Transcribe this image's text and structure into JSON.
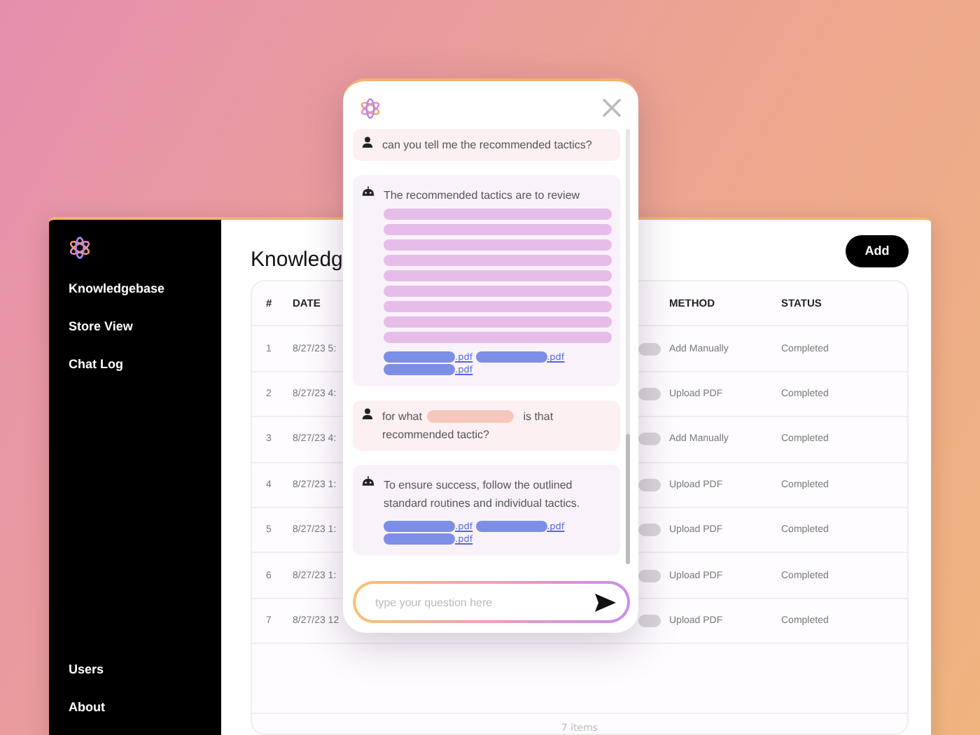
{
  "sidebar": {
    "items": [
      "Knowledgebase",
      "Store View",
      "Chat Log"
    ],
    "bottom_items": [
      "Users",
      "About"
    ]
  },
  "page": {
    "title": "Knowledg",
    "add_button": "Add"
  },
  "table": {
    "columns": [
      "#",
      "DATE",
      "METHOD",
      "STATUS"
    ],
    "rows": [
      {
        "index": "1",
        "date": "8/27/23 5:",
        "toggle_on": false,
        "method": "Add Manually",
        "status": "Completed"
      },
      {
        "index": "2",
        "date": "8/27/23 4:",
        "toggle_on": false,
        "method": "Upload PDF",
        "status": "Completed"
      },
      {
        "index": "3",
        "date": "8/27/23 4:",
        "toggle_on": false,
        "method": "Add Manually",
        "status": "Completed"
      },
      {
        "index": "4",
        "date": "8/27/23 1:",
        "toggle_on": false,
        "method": "Upload PDF",
        "status": "Completed"
      },
      {
        "index": "5",
        "date": "8/27/23 1:",
        "toggle_on": false,
        "method": "Upload PDF",
        "status": "Completed"
      },
      {
        "index": "6",
        "date": "8/27/23 1:",
        "toggle_on": false,
        "method": "Upload PDF",
        "status": "Completed"
      },
      {
        "index": "7",
        "date": "8/27/23 12",
        "toggle_on": false,
        "method": "Upload PDF",
        "status": "Completed"
      }
    ],
    "footer": "7 items"
  },
  "chat": {
    "messages": [
      {
        "kind": "user",
        "text": "can you tell me the recommended tactics?"
      },
      {
        "kind": "bot",
        "text": "The recommended tactics are to review",
        "redacted_block": true,
        "attachments": [
          ".pdf",
          ".pdf",
          ".pdf"
        ]
      },
      {
        "kind": "user",
        "text": "for what",
        "redacted_word": true,
        "text_after": "is that recommended tactic?"
      },
      {
        "kind": "bot",
        "text": "To ensure success, follow the outlined standard routines and individual tactics.",
        "attachments": [
          ".pdf",
          ".pdf",
          ".pdf"
        ]
      }
    ],
    "input": {
      "placeholder": "type your question here"
    }
  }
}
